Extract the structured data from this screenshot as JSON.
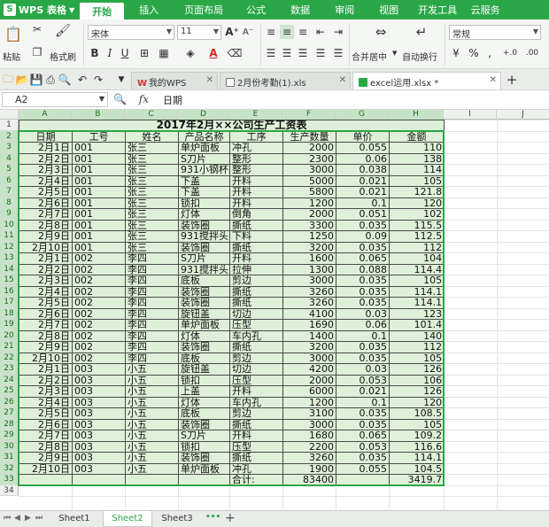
{
  "app": {
    "title": "WPS 表格"
  },
  "menu": {
    "tabs": [
      "开始",
      "插入",
      "页面布局",
      "公式",
      "数据",
      "审阅",
      "视图",
      "开发工具",
      "云服务"
    ],
    "active": 0
  },
  "ribbon": {
    "paste_label": "粘贴",
    "format_painter_label": "格式刷",
    "font_name": "宋体",
    "font_size": "11",
    "bold": "B",
    "italic": "I",
    "underline": "U",
    "grow_font": "A⁺",
    "shrink_font": "A⁻",
    "merge_center_label": "合并居中",
    "wrap_text_label": "自动换行",
    "number_format": "常规",
    "percent": "%",
    "thousands": ",",
    "yen": "¥",
    "dec_inc": "+.0",
    "dec_dec": ".00"
  },
  "docs": {
    "tabs": [
      {
        "label": "我的WPS"
      },
      {
        "label": "2月份考勤(1).xls"
      },
      {
        "label": "excel运用.xlsx *"
      }
    ],
    "active": 2
  },
  "formula": {
    "cell_ref": "A2",
    "fx": "fx",
    "value": "日期"
  },
  "grid": {
    "columns": [
      "A",
      "B",
      "C",
      "D",
      "E",
      "F",
      "G",
      "H",
      "I",
      "J"
    ],
    "selected_columns": [
      "A",
      "B",
      "C",
      "D",
      "E",
      "F",
      "G",
      "H"
    ],
    "rows": [
      "1",
      "2",
      "3",
      "4",
      "5",
      "6",
      "7",
      "8",
      "9",
      "10",
      "11",
      "12",
      "13",
      "14",
      "15",
      "16",
      "17",
      "18",
      "19",
      "20",
      "21",
      "22",
      "23",
      "24",
      "25",
      "26",
      "27",
      "28",
      "29",
      "30",
      "31",
      "32",
      "33",
      "34"
    ]
  },
  "table": {
    "title": "2017年2月××公司生产工资表",
    "headers": [
      "日期",
      "工号",
      "姓名",
      "产品名称",
      "工序",
      "生产数量",
      "单价",
      "金额"
    ],
    "rows": [
      [
        "2月1日",
        "001",
        "张三",
        "单炉面板",
        "冲孔",
        "2000",
        "0.055",
        "110"
      ],
      [
        "2月2日",
        "001",
        "张三",
        "S刀片",
        "整形",
        "2300",
        "0.06",
        "138"
      ],
      [
        "2月3日",
        "001",
        "张三",
        "931小钢杯",
        "整形",
        "3000",
        "0.038",
        "114"
      ],
      [
        "2月4日",
        "001",
        "张三",
        "下盖",
        "开料",
        "5000",
        "0.021",
        "105"
      ],
      [
        "2月5日",
        "001",
        "张三",
        "下盖",
        "开料",
        "5800",
        "0.021",
        "121.8"
      ],
      [
        "2月6日",
        "001",
        "张三",
        "锁扣",
        "开料",
        "1200",
        "0.1",
        "120"
      ],
      [
        "2月7日",
        "001",
        "张三",
        "灯体",
        "倒角",
        "2000",
        "0.051",
        "102"
      ],
      [
        "2月8日",
        "001",
        "张三",
        "装饰圈",
        "撕纸",
        "3300",
        "0.035",
        "115.5"
      ],
      [
        "2月9日",
        "001",
        "张三",
        "931搅拌头",
        "下料",
        "1250",
        "0.09",
        "112.5"
      ],
      [
        "2月10日",
        "001",
        "张三",
        "装饰圈",
        "撕纸",
        "3200",
        "0.035",
        "112"
      ],
      [
        "2月1日",
        "002",
        "李四",
        "S刀片",
        "开料",
        "1600",
        "0.065",
        "104"
      ],
      [
        "2月2日",
        "002",
        "李四",
        "931搅拌头",
        "拉伸",
        "1300",
        "0.088",
        "114.4"
      ],
      [
        "2月3日",
        "002",
        "李四",
        "底板",
        "剪边",
        "3000",
        "0.035",
        "105"
      ],
      [
        "2月4日",
        "002",
        "李四",
        "装饰圈",
        "撕纸",
        "3260",
        "0.035",
        "114.1"
      ],
      [
        "2月5日",
        "002",
        "李四",
        "装饰圈",
        "撕纸",
        "3260",
        "0.035",
        "114.1"
      ],
      [
        "2月6日",
        "002",
        "李四",
        "旋钮盖",
        "切边",
        "4100",
        "0.03",
        "123"
      ],
      [
        "2月7日",
        "002",
        "李四",
        "单炉面板",
        "压型",
        "1690",
        "0.06",
        "101.4"
      ],
      [
        "2月8日",
        "002",
        "李四",
        "灯体",
        "车内孔",
        "1400",
        "0.1",
        "140"
      ],
      [
        "2月9日",
        "002",
        "李四",
        "装饰圈",
        "撕纸",
        "3200",
        "0.035",
        "112"
      ],
      [
        "2月10日",
        "002",
        "李四",
        "底板",
        "剪边",
        "3000",
        "0.035",
        "105"
      ],
      [
        "2月1日",
        "003",
        "小五",
        "旋钮盖",
        "切边",
        "4200",
        "0.03",
        "126"
      ],
      [
        "2月2日",
        "003",
        "小五",
        "锁扣",
        "压型",
        "2000",
        "0.053",
        "106"
      ],
      [
        "2月3日",
        "003",
        "小五",
        "上盖",
        "开料",
        "6000",
        "0.021",
        "126"
      ],
      [
        "2月4日",
        "003",
        "小五",
        "灯体",
        "车内孔",
        "1200",
        "0.1",
        "120"
      ],
      [
        "2月5日",
        "003",
        "小五",
        "底板",
        "剪边",
        "3100",
        "0.035",
        "108.5"
      ],
      [
        "2月6日",
        "003",
        "小五",
        "装饰圈",
        "撕纸",
        "3000",
        "0.035",
        "105"
      ],
      [
        "2月7日",
        "003",
        "小五",
        "S刀片",
        "开料",
        "1680",
        "0.065",
        "109.2"
      ],
      [
        "2月8日",
        "003",
        "小五",
        "锁扣",
        "压型",
        "2200",
        "0.053",
        "116.6"
      ],
      [
        "2月9日",
        "003",
        "小五",
        "装饰圈",
        "撕纸",
        "3260",
        "0.035",
        "114.1"
      ],
      [
        "2月10日",
        "003",
        "小五",
        "单炉面板",
        "冲孔",
        "1900",
        "0.055",
        "104.5"
      ]
    ],
    "total": [
      "",
      "",
      "",
      "",
      "合计:",
      "83400",
      "",
      "3419.7"
    ]
  },
  "sheets": {
    "tabs": [
      "Sheet1",
      "Sheet2",
      "Sheet3"
    ],
    "active": 1,
    "more": "•••",
    "add": "+"
  },
  "colors": {
    "brand": "#2aa848",
    "table_fill": "#dff0d8",
    "header_fill": "#eef0ee"
  }
}
